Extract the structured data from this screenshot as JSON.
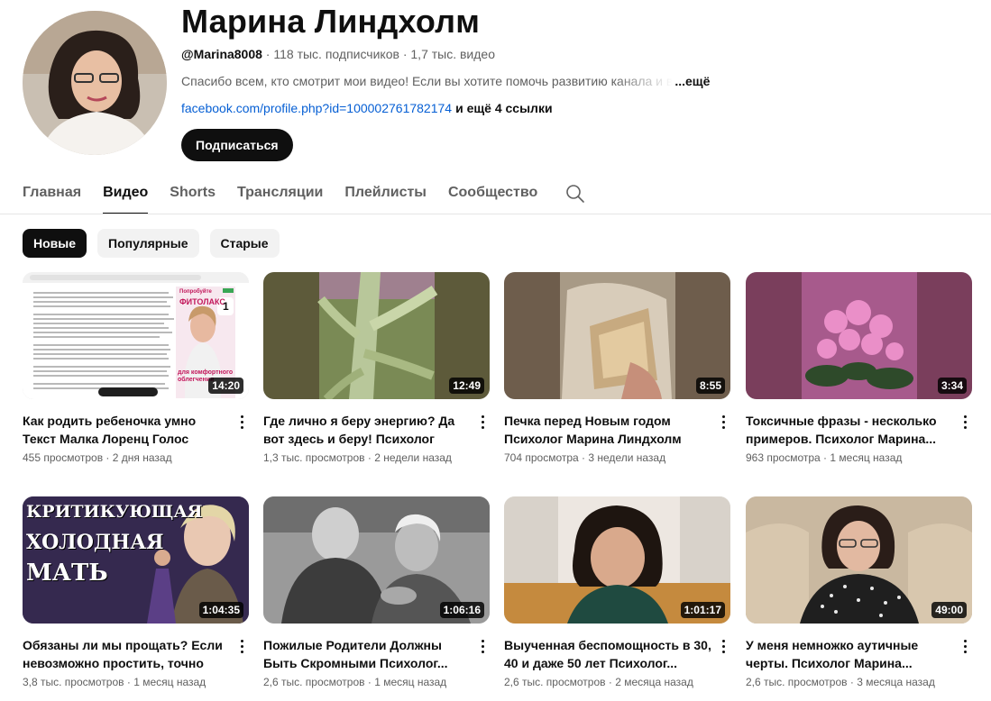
{
  "channel": {
    "name": "Марина Линдхолм",
    "handle": "@Marina8008",
    "subscribers": "118 тыс. подписчиков",
    "videos_count": "1,7 тыс. видео",
    "separator": " · ",
    "description": "Спасибо всем, кто смотрит мои видео! Если вы хотите помочь развитию канала и в",
    "more_label": "...ещё",
    "link": "facebook.com/profile.php?id=100002761782174",
    "more_links": "и ещё 4 ссылки",
    "subscribe_label": "Подписаться"
  },
  "tabs": [
    {
      "label": "Главная",
      "active": false
    },
    {
      "label": "Видео",
      "active": true
    },
    {
      "label": "Shorts",
      "active": false
    },
    {
      "label": "Трансляции",
      "active": false
    },
    {
      "label": "Плейлисты",
      "active": false
    },
    {
      "label": "Сообщество",
      "active": false
    }
  ],
  "chips": [
    {
      "label": "Новые",
      "active": true
    },
    {
      "label": "Популярные",
      "active": false
    },
    {
      "label": "Старые",
      "active": false
    }
  ],
  "videos": [
    {
      "title": "Как родить ребеночка умно Текст Малка Лоренц Голос Марина...",
      "views": "455 просмотров",
      "date": "2 дня назад",
      "duration": "14:20"
    },
    {
      "title": "Где лично я беру энергию? Да вот здесь и беру! Психолог Марина...",
      "views": "1,3 тыс. просмотров",
      "date": "2 недели назад",
      "duration": "12:49"
    },
    {
      "title": "Печка перед Новым годом Психолог Марина Линдхолм",
      "views": "704 просмотра",
      "date": "3 недели назад",
      "duration": "8:55"
    },
    {
      "title": "Токсичные фразы - несколько примеров. Психолог Марина...",
      "views": "963 просмотра",
      "date": "1 месяц назад",
      "duration": "3:34"
    },
    {
      "title": "Обязаны ли мы прощать? Если невозможно простить, точно ли...",
      "views": "3,8 тыс. просмотров",
      "date": "1 месяц назад",
      "duration": "1:04:35"
    },
    {
      "title": "Пожилые Родители Должны Быть Скромными Психолог...",
      "views": "2,6 тыс. просмотров",
      "date": "1 месяц назад",
      "duration": "1:06:16"
    },
    {
      "title": "Выученная беспомощность в 30, 40 и даже 50 лет Психолог...",
      "views": "2,6 тыс. просмотров",
      "date": "2 месяца назад",
      "duration": "1:01:17"
    },
    {
      "title": "У меня немножко аутичные черты. Психолог Марина...",
      "views": "2,6 тыс. просмотров",
      "date": "3 месяца назад",
      "duration": "49:00"
    }
  ],
  "thumb_texts": {
    "ad_title": "ФИТОЛАКС",
    "ad_top": "Попробуйте",
    "ad_bottom": "для комфортного облегчения",
    "ad_number": "1",
    "v5_line1": "КРИТИКУЮЩАЯ",
    "v5_line2": "ХОЛОДНАЯ",
    "v5_line3": "МАТЬ"
  },
  "icons": [
    "search-icon",
    "more-vert-icon"
  ]
}
